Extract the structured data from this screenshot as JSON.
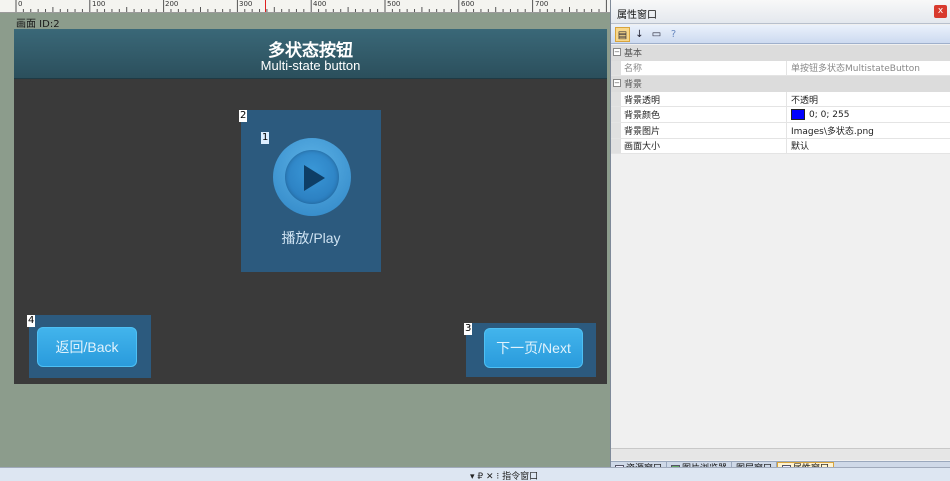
{
  "ruler": {
    "labels": [
      "0",
      "100",
      "200",
      "300",
      "400",
      "500",
      "600",
      "700"
    ]
  },
  "canvas": {
    "id_label": "画面 ID:2",
    "title_cn": "多状态按钮",
    "title_en": "Multi-state button",
    "play_label": "播放/Play",
    "back_label": "返回/Back",
    "next_label": "下一页/Next",
    "numbers": {
      "play_box": "2",
      "play_icon": "1",
      "next_box": "3",
      "back_box": "4"
    }
  },
  "panel": {
    "title": "属性窗口",
    "close": "x",
    "categories": {
      "basic": "基本",
      "background": "背景"
    },
    "rows": {
      "name": {
        "label": "名称",
        "value": "单按钮多状态MultistateButton"
      },
      "transparency": {
        "label": "背景透明",
        "value": "不透明"
      },
      "color": {
        "label": "背景颜色",
        "value": "0; 0; 255",
        "swatch": "#0000ff"
      },
      "image": {
        "label": "背景图片",
        "value": "Images\\多状态.png"
      },
      "size": {
        "label": "画面大小",
        "value": "默认"
      }
    },
    "tabs": [
      "资源窗口",
      "图片浏览器",
      "图层窗口",
      "属性窗口"
    ]
  },
  "bottom": {
    "commands": "▾ ₽ ✕  ⁝ 指令窗口"
  }
}
